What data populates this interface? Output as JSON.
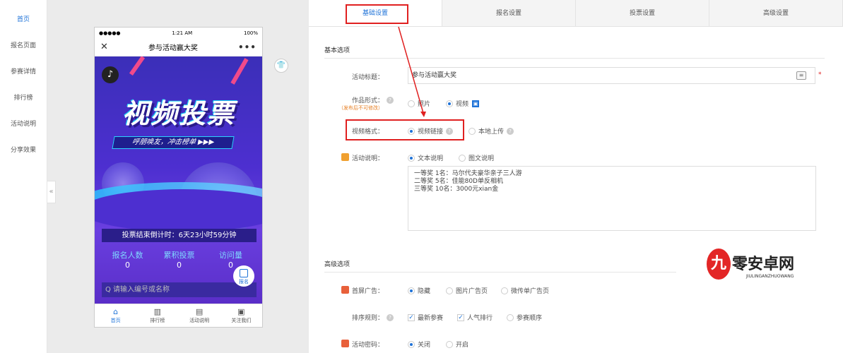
{
  "left_nav": {
    "items": [
      {
        "label": "首页",
        "active": true
      },
      {
        "label": "报名页面",
        "active": false
      },
      {
        "label": "参赛详情",
        "active": false
      },
      {
        "label": "排行榜",
        "active": false
      },
      {
        "label": "活动说明",
        "active": false
      },
      {
        "label": "分享效果",
        "active": false
      }
    ],
    "collapse_glyph": "«"
  },
  "phone": {
    "status": {
      "signal": "●●●●●",
      "time": "1:21 AM",
      "battery": "100%"
    },
    "title": "参与活动赢大奖",
    "close_glyph": "✕",
    "more_glyph": "•••",
    "banner": {
      "music_glyph": "♪",
      "headline": "视频投票",
      "slogan": "呼朋唤友，冲击榜单 ▶▶▶"
    },
    "countdown": "投票结束倒计时：6天23小时59分钟",
    "stats": [
      {
        "label": "报名人数",
        "value": "0"
      },
      {
        "label": "累积投票",
        "value": "0"
      },
      {
        "label": "访问量",
        "value": "0"
      }
    ],
    "signup_label": "报名",
    "search_placeholder": "Q 请输入编号或名称",
    "bottom_tabs": [
      {
        "label": "首页",
        "icon": "home-icon",
        "glyph": "⌂",
        "active": true
      },
      {
        "label": "排行榜",
        "icon": "bar-chart-icon",
        "glyph": "▥",
        "active": false
      },
      {
        "label": "活动说明",
        "icon": "document-icon",
        "glyph": "▤",
        "active": false
      },
      {
        "label": "关注我们",
        "icon": "window-icon",
        "glyph": "▣",
        "active": false
      }
    ]
  },
  "shirt_icon_glyph": "👕",
  "tabs": [
    {
      "label": "基础设置",
      "active": true
    },
    {
      "label": "报名设置",
      "active": false
    },
    {
      "label": "投票设置",
      "active": false
    },
    {
      "label": "高级设置",
      "active": false
    }
  ],
  "basic": {
    "section_title": "基本选项",
    "activity_title_label": "活动标题：",
    "activity_title_value": "参与活动赢大奖",
    "required_mark": "*",
    "work_form_label": "作品形式：",
    "work_form_note": "（发布后不可修改）",
    "work_form_options": [
      {
        "label": "照片",
        "selected": false
      },
      {
        "label": "视频",
        "selected": true
      }
    ],
    "video_format_label": "视频格式：",
    "video_format_options": [
      {
        "label": "视频链接",
        "selected": true
      },
      {
        "label": "本地上传",
        "selected": false
      }
    ],
    "desc_label": "活动说明：",
    "desc_options": [
      {
        "label": "文本说明",
        "selected": true
      },
      {
        "label": "图文说明",
        "selected": false
      }
    ],
    "desc_text": "一等奖 1名：马尔代夫豪华亲子三人游\n二等奖 5名：佳能80D单反相机\n三等奖 10名：3000元xian金"
  },
  "advanced": {
    "section_title": "高级选项",
    "ad_label": "首屏广告：",
    "ad_options": [
      {
        "label": "隐藏",
        "selected": true
      },
      {
        "label": "图片广告页",
        "selected": false
      },
      {
        "label": "微传单广告页",
        "selected": false
      }
    ],
    "sort_label": "排序规则：",
    "sort_options": [
      {
        "label": "最新参赛",
        "checked": true
      },
      {
        "label": "人气排行",
        "checked": true
      },
      {
        "label": "参赛顺序",
        "checked": false
      }
    ],
    "password_label": "活动密码：",
    "password_options": [
      {
        "label": "关闭",
        "selected": true
      },
      {
        "label": "开启",
        "selected": false
      }
    ]
  },
  "watermark": {
    "cn": "零安卓网",
    "en": "JIULINGANZHUOWANG",
    "logo": "九"
  },
  "colors": {
    "accent": "#1f73d8",
    "highlight": "#e02020",
    "orange": "#e67e22",
    "banner": "#4d2fd0"
  }
}
